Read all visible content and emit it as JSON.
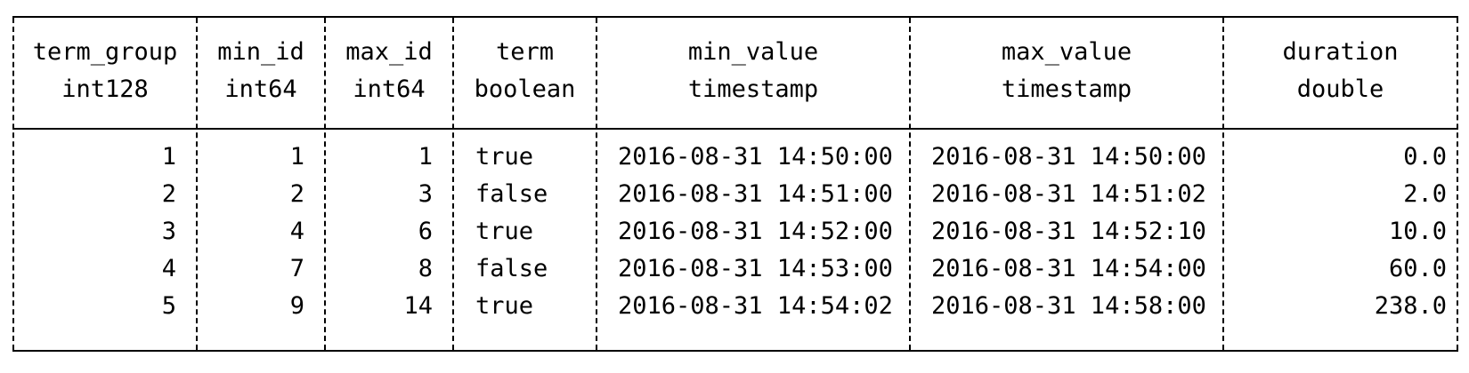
{
  "table": {
    "columns": [
      {
        "name": "term_group",
        "type": "int128"
      },
      {
        "name": "min_id",
        "type": "int64"
      },
      {
        "name": "max_id",
        "type": "int64"
      },
      {
        "name": "term",
        "type": "boolean"
      },
      {
        "name": "min_value",
        "type": "timestamp"
      },
      {
        "name": "max_value",
        "type": "timestamp"
      },
      {
        "name": "duration",
        "type": "double"
      }
    ],
    "rows": [
      [
        "1",
        "1",
        "1",
        "true",
        "2016-08-31 14:50:00",
        "2016-08-31 14:50:00",
        "0.0"
      ],
      [
        "2",
        "2",
        "3",
        "false",
        "2016-08-31 14:51:00",
        "2016-08-31 14:51:02",
        "2.0"
      ],
      [
        "3",
        "4",
        "6",
        "true",
        "2016-08-31 14:52:00",
        "2016-08-31 14:52:10",
        "10.0"
      ],
      [
        "4",
        "7",
        "8",
        "false",
        "2016-08-31 14:53:00",
        "2016-08-31 14:54:00",
        "60.0"
      ],
      [
        "5",
        "9",
        "14",
        "true",
        "2016-08-31 14:54:02",
        "2016-08-31 14:58:00",
        "238.0"
      ]
    ]
  }
}
